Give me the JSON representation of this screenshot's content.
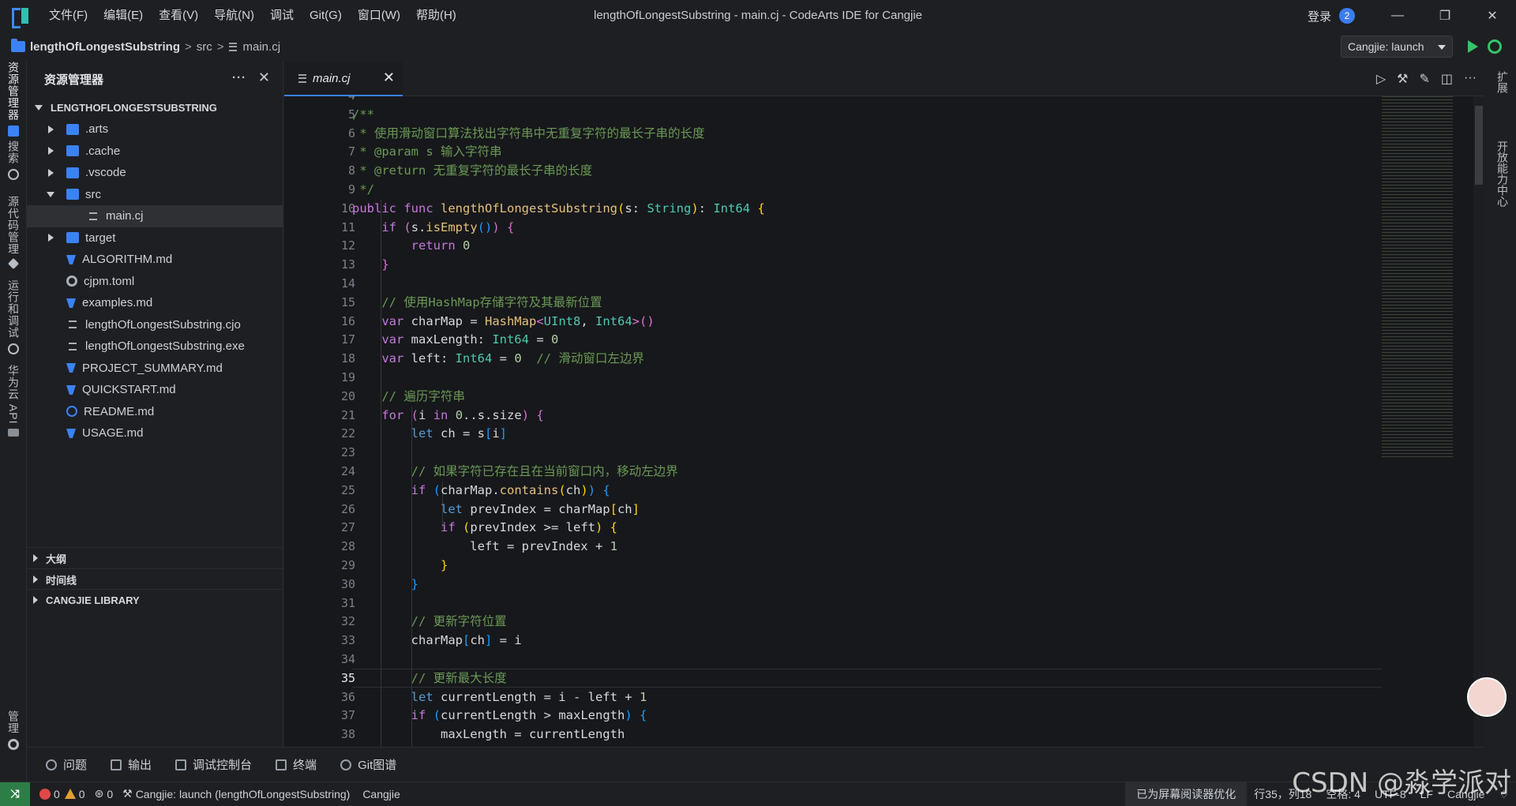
{
  "titlebar": {
    "menu": [
      "文件(F)",
      "编辑(E)",
      "查看(V)",
      "导航(N)",
      "调试",
      "Git(G)",
      "窗口(W)",
      "帮助(H)"
    ],
    "window_title": "lengthOfLongestSubstring - main.cj - CodeArts IDE for Cangjie",
    "login": "登录",
    "notification_count": "2"
  },
  "breadcrumb": {
    "project": "lengthOfLongestSubstring",
    "folder": "src",
    "file": "main.cj",
    "sep": ">"
  },
  "run": {
    "config": "Cangjie: launch"
  },
  "activity": {
    "explorer": "资源管理器",
    "search": "搜索",
    "scm": "源代码管理",
    "run_debug": "运行和调试",
    "huawei_api": "华为云 API",
    "manage": "管理"
  },
  "rightbar": {
    "extensions": "扩展",
    "open_center": "开放能力中心"
  },
  "explorer": {
    "title": "资源管理器",
    "project_root": "LENGTHOFLONGESTSUBSTRING",
    "items": [
      {
        "name": ".arts",
        "kind": "folder",
        "expand": "collapsed",
        "depth": 0
      },
      {
        "name": ".cache",
        "kind": "folder",
        "expand": "collapsed",
        "depth": 0
      },
      {
        "name": ".vscode",
        "kind": "folder",
        "expand": "collapsed",
        "depth": 0
      },
      {
        "name": "src",
        "kind": "folder",
        "expand": "expanded",
        "depth": 0
      },
      {
        "name": "main.cj",
        "kind": "doc",
        "expand": "none",
        "depth": 1,
        "selected": true
      },
      {
        "name": "target",
        "kind": "folder",
        "expand": "collapsed",
        "depth": 0
      },
      {
        "name": "ALGORITHM.md",
        "kind": "md",
        "expand": "none",
        "depth": 0
      },
      {
        "name": "cjpm.toml",
        "kind": "gear",
        "expand": "none",
        "depth": 0
      },
      {
        "name": "examples.md",
        "kind": "md",
        "expand": "none",
        "depth": 0
      },
      {
        "name": "lengthOfLongestSubstring.cjo",
        "kind": "doc",
        "expand": "none",
        "depth": 0
      },
      {
        "name": "lengthOfLongestSubstring.exe",
        "kind": "doc",
        "expand": "none",
        "depth": 0
      },
      {
        "name": "PROJECT_SUMMARY.md",
        "kind": "md",
        "expand": "none",
        "depth": 0
      },
      {
        "name": "QUICKSTART.md",
        "kind": "md",
        "expand": "none",
        "depth": 0
      },
      {
        "name": "README.md",
        "kind": "info",
        "expand": "none",
        "depth": 0
      },
      {
        "name": "USAGE.md",
        "kind": "md",
        "expand": "none",
        "depth": 0
      }
    ],
    "sections": [
      "大纲",
      "时间线",
      "CANGJIE LIBRARY"
    ]
  },
  "editor": {
    "tab_label": "main.cj",
    "current_line": 35,
    "lines": [
      {
        "n": 4,
        "html": ""
      },
      {
        "n": 5,
        "html": "<span class=\"cm\">/**</span>"
      },
      {
        "n": 6,
        "html": "<span class=\"cm\"> * 使用滑动窗口算法找出字符串中无重复字符的最长子串的长度</span>"
      },
      {
        "n": 7,
        "html": "<span class=\"cm\"> * @param s 输入字符串</span>"
      },
      {
        "n": 8,
        "html": "<span class=\"cm\"> * @return 无重复字符的最长子串的长度</span>"
      },
      {
        "n": 9,
        "html": "<span class=\"cm\"> */</span>"
      },
      {
        "n": 10,
        "html": "<span class=\"kw\">public</span> <span class=\"kw\">func</span> <span class=\"fn\">lengthOfLongestSubstring</span><span class=\"br1\">(</span>s: <span class=\"ty\">String</span><span class=\"br1\">)</span>: <span class=\"ty\">Int64</span> <span class=\"br1\">{</span>"
      },
      {
        "n": 11,
        "html": "    <span class=\"kw\">if</span> <span class=\"br2\">(</span>s.<span class=\"fn\">isEmpty</span><span class=\"br3\">()</span><span class=\"br2\">)</span> <span class=\"br2\">{</span>"
      },
      {
        "n": 12,
        "html": "        <span class=\"kw\">return</span> <span class=\"nm\">0</span>"
      },
      {
        "n": 13,
        "html": "    <span class=\"br2\">}</span>"
      },
      {
        "n": 14,
        "html": ""
      },
      {
        "n": 15,
        "html": "    <span class=\"cm\">// 使用HashMap存储字符及其最新位置</span>"
      },
      {
        "n": 16,
        "html": "    <span class=\"kw\">var</span> charMap = <span class=\"fn\">HashMap</span><span class=\"br2\">&lt;</span><span class=\"ty\">UInt8</span>, <span class=\"ty\">Int64</span><span class=\"br2\">&gt;()</span>"
      },
      {
        "n": 17,
        "html": "    <span class=\"kw\">var</span> maxLength: <span class=\"ty\">Int64</span> = <span class=\"nm\">0</span>"
      },
      {
        "n": 18,
        "html": "    <span class=\"kw\">var</span> left: <span class=\"ty\">Int64</span> = <span class=\"nm\">0</span>  <span class=\"cm\">// 滑动窗口左边界</span>"
      },
      {
        "n": 19,
        "html": ""
      },
      {
        "n": 20,
        "html": "    <span class=\"cm\">// 遍历字符串</span>"
      },
      {
        "n": 21,
        "html": "    <span class=\"kw\">for</span> <span class=\"br2\">(</span>i <span class=\"kw\">in</span> <span class=\"nm\">0</span>..s.size<span class=\"br2\">)</span> <span class=\"br2\">{</span>"
      },
      {
        "n": 22,
        "html": "        <span class=\"cmk\">let</span> ch = s<span class=\"br3\">[</span>i<span class=\"br3\">]</span>"
      },
      {
        "n": 23,
        "html": ""
      },
      {
        "n": 24,
        "html": "        <span class=\"cm\">// 如果字符已存在且在当前窗口内，移动左边界</span>"
      },
      {
        "n": 25,
        "html": "        <span class=\"kw\">if</span> <span class=\"br3\">(</span>charMap.<span class=\"fn\">contains</span><span class=\"br1\">(</span>ch<span class=\"br1\">)</span><span class=\"br3\">)</span> <span class=\"br3\">{</span>"
      },
      {
        "n": 26,
        "html": "            <span class=\"cmk\">let</span> prevIndex = charMap<span class=\"br1\">[</span>ch<span class=\"br1\">]</span>"
      },
      {
        "n": 27,
        "html": "            <span class=\"kw\">if</span> <span class=\"br1\">(</span>prevIndex &gt;= left<span class=\"br1\">)</span> <span class=\"br1\">{</span>"
      },
      {
        "n": 28,
        "html": "                left = prevIndex + <span class=\"nm\">1</span>"
      },
      {
        "n": 29,
        "html": "            <span class=\"br1\">}</span>"
      },
      {
        "n": 30,
        "html": "        <span class=\"br3\">}</span>"
      },
      {
        "n": 31,
        "html": ""
      },
      {
        "n": 32,
        "html": "        <span class=\"cm\">// 更新字符位置</span>"
      },
      {
        "n": 33,
        "html": "        charMap<span class=\"br3\">[</span>ch<span class=\"br3\">]</span> = i"
      },
      {
        "n": 34,
        "html": ""
      },
      {
        "n": 35,
        "html": "        <span class=\"cm\">// 更新最大长度</span>"
      },
      {
        "n": 36,
        "html": "        <span class=\"cmk\">let</span> currentLength = i - left + <span class=\"nm\">1</span>"
      },
      {
        "n": 37,
        "html": "        <span class=\"kw\">if</span> <span class=\"br3\">(</span>currentLength &gt; maxLength<span class=\"br3\">)</span> <span class=\"br3\">{</span>"
      },
      {
        "n": 38,
        "html": "            maxLength = currentLength"
      }
    ]
  },
  "panel": {
    "tabs": [
      "问题",
      "输出",
      "调试控制台",
      "终端",
      "Git图谱"
    ]
  },
  "statusbar": {
    "errors": "0",
    "warnings": "0",
    "ports": "0",
    "launch": "Cangjie: launch (lengthOfLongestSubstring)",
    "language_server": "Cangjie",
    "screen_reader": "已为屏幕阅读器优化",
    "cursor": "行35，列18",
    "indent": "空格: 4",
    "encoding": "UTF-8",
    "eol": "LF",
    "mode": "Cangjie"
  },
  "watermark": "CSDN @淼学派对"
}
